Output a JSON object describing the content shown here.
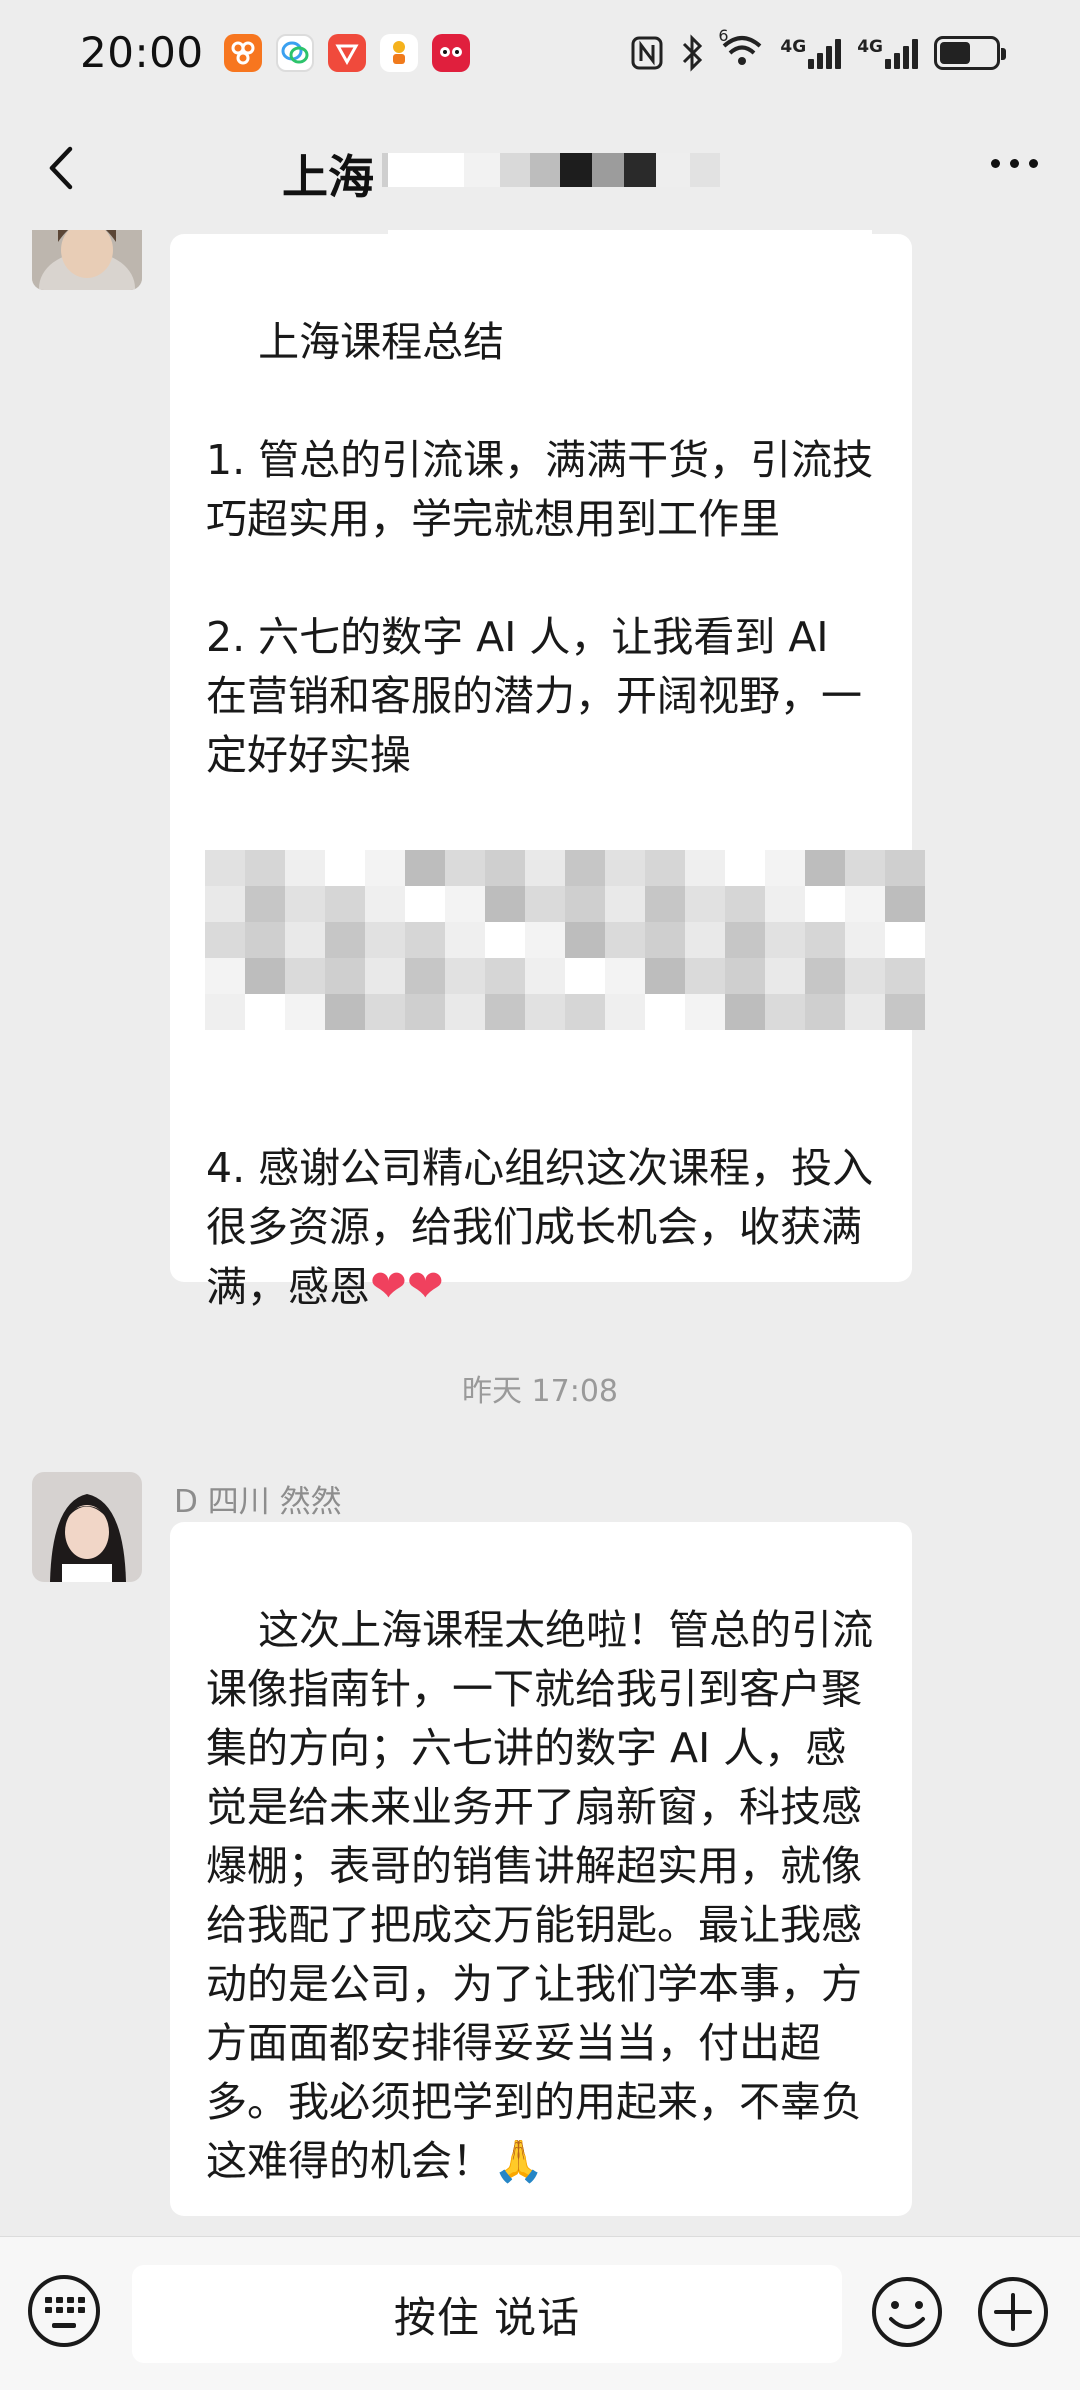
{
  "status_bar": {
    "time": "20:00",
    "network_label_1": "4G",
    "network_label_2": "4G",
    "wifi_label": "6",
    "icons": [
      "app-orange-icon",
      "chat-bubble-icon",
      "shield-app-icon",
      "tea-app-icon",
      "tmall-icon",
      "nfc-icon",
      "bluetooth-icon",
      "wifi-icon",
      "signal-icon",
      "battery-icon"
    ]
  },
  "nav": {
    "title": "上海",
    "back_icon": "chevron-left-icon",
    "more_icon": "more-dots-icon"
  },
  "messages": [
    {
      "type": "incoming",
      "text": "上海课程总结\n\n1. 管总的引流课，满满干货，引流技巧超实用，学完就想用到工作里\n\n2. 六七的数字 AI 人，让我看到 AI 在营销和客服的潜力，开阔视野，一定好好实操\n\n3. 表哥的销售讲解，\n\n\n\n\n4. 感谢公司精心组织这次课程，投入很多资源，给我们成长机会，收获满满，感恩",
      "trailing_emoji": "❤❤"
    },
    {
      "type": "time",
      "text": "昨天 17:08"
    },
    {
      "type": "incoming",
      "sender": "D 四川 然然",
      "text": "这次上海课程太绝啦！管总的引流课像指南针，一下就给我引到客户聚集的方向；六七讲的数字 AI 人，感觉是给未来业务开了扇新窗，科技感爆棚；表哥的销售讲解超实用，就像给我配了把成交万能钥匙。最让我感动的是公司，为了让我们学本事，方方面面都安排得妥妥当当，付出超多。我必须把学到的用起来，不辜负这难得的机会！",
      "trailing_emoji": "🙏"
    }
  ],
  "input_bar": {
    "voice_label": "按住 说话",
    "left_icon": "keyboard-icon",
    "emoji_icon": "smile-icon",
    "plus_icon": "plus-icon"
  },
  "colors": {
    "background": "#ededed",
    "bubble": "#ffffff",
    "heart": "#f0415e"
  }
}
